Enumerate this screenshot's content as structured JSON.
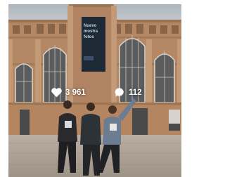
{
  "post": {
    "likes_count": "3 961",
    "comments_count": "112",
    "banner_lines": [
      "Nuevo",
      "mostra",
      "fotos"
    ]
  },
  "icons": {
    "likes": "heart-icon",
    "comments": "comment-bubble-icon"
  },
  "colors": {
    "overlay_text": "#ffffff",
    "brick": "#b78a66",
    "sky": "#c9ced3",
    "banner": "#1c2a36"
  }
}
